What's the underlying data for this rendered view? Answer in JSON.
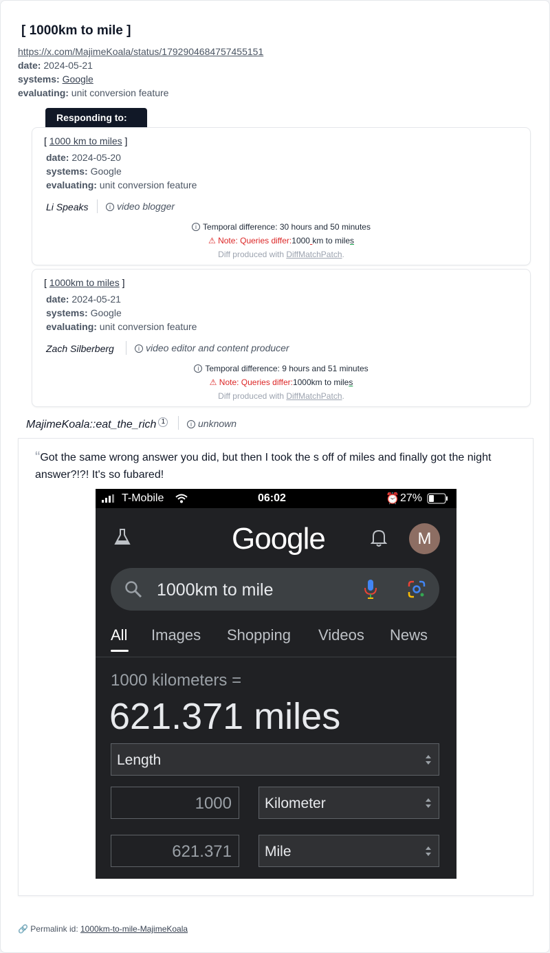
{
  "header": {
    "title": "[ 1000km to mile ]",
    "url": "https://x.com/MajimeKoala/status/1792904684757455151",
    "date_label": "date:",
    "date": "2024-05-21",
    "systems_label": "systems:",
    "systems": "Google",
    "evaluating_label": "evaluating:",
    "evaluating": "unit conversion feature"
  },
  "responding": {
    "tab_label": "Responding to:",
    "items": [
      {
        "bracket_open": "[",
        "title": "1000 km to miles",
        "bracket_close": "]",
        "date": "2024-05-20",
        "systems": "Google",
        "evaluating": "unit conversion feature",
        "author": "Li Speaks",
        "role": "video blogger",
        "temporal": "Temporal difference: 30 hours and 50 minutes",
        "note": "Note: Queries differ:",
        "diff_a": "1000",
        "diff_b": " ",
        "diff_c": "km to mile",
        "diff_d": "s",
        "diff_tool_prefix": "Diff produced with",
        "diff_tool": "DiffMatchPatch",
        "diff_tool_suffix": "."
      },
      {
        "bracket_open": "[",
        "title": "1000km to miles",
        "bracket_close": "]",
        "date": "2024-05-21",
        "systems": "Google",
        "evaluating": "unit conversion feature",
        "author": "Zach Silberberg",
        "role": "video editor and content producer",
        "temporal": "Temporal difference: 9 hours and 51 minutes",
        "note": "Note: Queries differ:",
        "diff_a": "1000km to mile",
        "diff_d": "s",
        "diff_tool_prefix": "Diff produced with",
        "diff_tool": "DiffMatchPatch",
        "diff_tool_suffix": "."
      }
    ]
  },
  "post": {
    "author": "MajimeKoala::eat_the_rich",
    "footnote": "1",
    "role": "unknown",
    "quote": "Got the same wrong answer you did, but then I took the s off of miles and finally got the night answer?!?! It's so fubared!",
    "screenshot": {
      "carrier": "T-Mobile",
      "time": "06:02",
      "battery": "27%",
      "logo": "Google",
      "avatar_letter": "M",
      "query": "1000km to mile",
      "tabs": [
        "All",
        "Images",
        "Shopping",
        "Videos",
        "News"
      ],
      "result_label": "1000 kilometers =",
      "result_value": "621.371 miles",
      "category": "Length",
      "from_value": "1000",
      "from_unit": "Kilometer",
      "to_value": "621.371",
      "to_unit": "Mile"
    }
  },
  "footer": {
    "permalink_label": "Permalink id:",
    "permalink_id": "1000km-to-mile-MajimeKoala"
  }
}
